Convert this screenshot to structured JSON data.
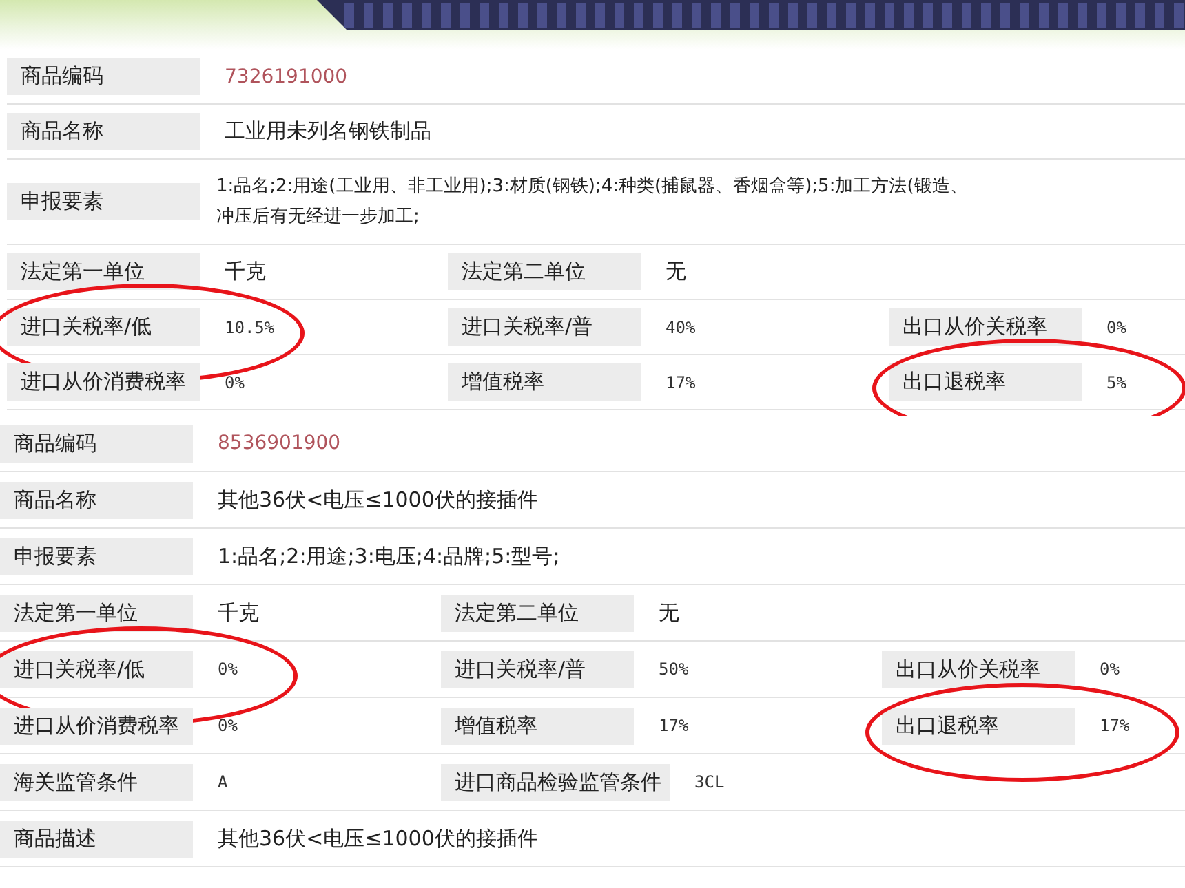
{
  "records": [
    {
      "rows": [
        [
          {
            "label": "商品编码",
            "value": [
              "7326191000"
            ],
            "kind": "code",
            "circled": false
          }
        ],
        [
          {
            "label": "商品名称",
            "value": [
              "工业用未列名钢铁制品"
            ],
            "kind": "text",
            "circled": false
          }
        ],
        [
          {
            "label": "申报要素",
            "value": [
              "1:品名;2:用途(工业用、非工业用);3:材质(钢铁);4:种类(捕鼠器、香烟盒等);5:加工方法(锻造、",
              "冲压后有无经进一步加工;"
            ],
            "kind": "text",
            "circled": false
          }
        ],
        [
          {
            "label": "法定第一单位",
            "value": [
              "千克"
            ],
            "kind": "text",
            "circled": false
          },
          {
            "label": "法定第二单位",
            "value": [
              "无"
            ],
            "kind": "text",
            "circled": false
          }
        ],
        [
          {
            "label": "进口关税率/低",
            "value": [
              "10.5%"
            ],
            "kind": "rate",
            "circled": true
          },
          {
            "label": "进口关税率/普",
            "value": [
              "40%"
            ],
            "kind": "rate",
            "circled": false
          },
          {
            "label": "出口从价关税率",
            "value": [
              "0%"
            ],
            "kind": "rate",
            "circled": false
          }
        ],
        [
          {
            "label": "进口从价消费税率",
            "value": [
              "0%"
            ],
            "kind": "rate",
            "circled": false
          },
          {
            "label": "增值税率",
            "value": [
              "17%"
            ],
            "kind": "rate",
            "circled": false
          },
          {
            "label": "出口退税率",
            "value": [
              "5%"
            ],
            "kind": "rate",
            "circled": true
          }
        ]
      ]
    },
    {
      "rows": [
        [
          {
            "label": "商品编码",
            "value": [
              "8536901900"
            ],
            "kind": "code",
            "circled": false
          }
        ],
        [
          {
            "label": "商品名称",
            "value": [
              "其他36伏<电压≤1000伏的接插件"
            ],
            "kind": "text",
            "circled": false
          }
        ],
        [
          {
            "label": "申报要素",
            "value": [
              "1:品名;2:用途;3:电压;4:品牌;5:型号;"
            ],
            "kind": "text",
            "circled": false
          }
        ],
        [
          {
            "label": "法定第一单位",
            "value": [
              "千克"
            ],
            "kind": "text",
            "circled": false
          },
          {
            "label": "法定第二单位",
            "value": [
              "无"
            ],
            "kind": "text",
            "circled": false
          }
        ],
        [
          {
            "label": "进口关税率/低",
            "value": [
              "0%"
            ],
            "kind": "rate",
            "circled": true
          },
          {
            "label": "进口关税率/普",
            "value": [
              "50%"
            ],
            "kind": "rate",
            "circled": false
          },
          {
            "label": "出口从价关税率",
            "value": [
              "0%"
            ],
            "kind": "rate",
            "circled": false
          }
        ],
        [
          {
            "label": "进口从价消费税率",
            "value": [
              "0%"
            ],
            "kind": "rate",
            "circled": false
          },
          {
            "label": "增值税率",
            "value": [
              "17%"
            ],
            "kind": "rate",
            "circled": false
          },
          {
            "label": "出口退税率",
            "value": [
              "17%"
            ],
            "kind": "rate",
            "circled": true
          }
        ],
        [
          {
            "label": "海关监管条件",
            "value": [
              "A"
            ],
            "kind": "rate",
            "circled": false
          },
          {
            "label": "进口商品检验监管条件",
            "value": [
              "3CL"
            ],
            "kind": "rate",
            "circled": false
          }
        ],
        [
          {
            "label": "商品描述",
            "value": [
              "其他36伏<电压≤1000伏的接插件"
            ],
            "kind": "text",
            "circled": false
          }
        ]
      ]
    }
  ]
}
